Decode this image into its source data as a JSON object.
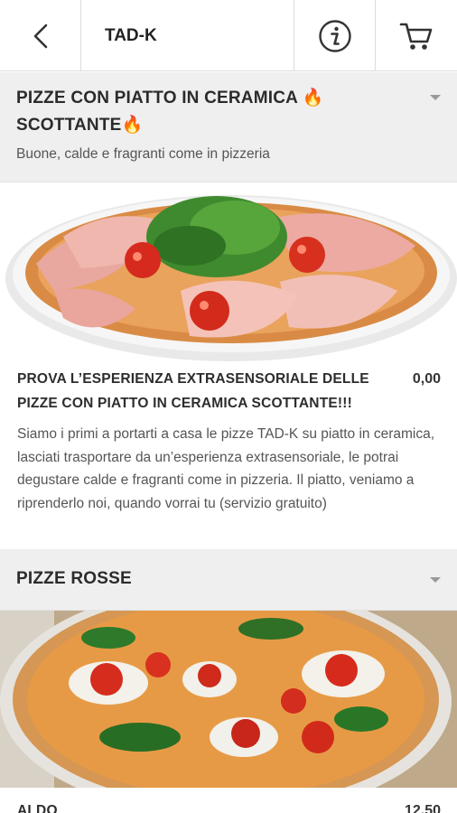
{
  "header": {
    "title": "TAD-K",
    "back_icon": "chevron-left-icon",
    "info_icon": "info-icon",
    "cart_icon": "cart-icon"
  },
  "sections": [
    {
      "title": "PIZZE CON PIATTO IN CERAMICA 🔥 SCOTTANTE🔥",
      "subtitle": "Buone, calde e fragranti come in pizzeria",
      "items": [
        {
          "name": "PROVA L’ESPERIENZA EXTRASENSORIALE DELLE PIZZE CON PIATTO IN CERAMICA SCOTTANTE!!!",
          "price": "0,00",
          "description": "Siamo i primi a portarti a casa le pizze TAD-K su piatto in ceramica, lasciati trasportare da un’esperienza extrasensoriale, le potrai degustare calde e fragranti come in pizzeria. Il piatto, veniamo a riprenderlo noi, quando vorrai tu (servizio gratuito)"
        }
      ]
    },
    {
      "title": "PIZZE ROSSE",
      "items": [
        {
          "name": "ALDO",
          "price": "12,50"
        }
      ]
    }
  ],
  "colors": {
    "header_bg": "#efefef",
    "accent": "#2b2b2b"
  }
}
